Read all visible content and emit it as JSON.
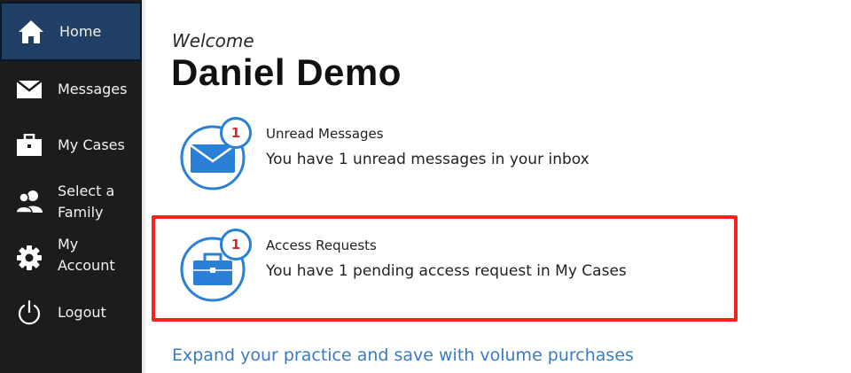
{
  "sidebar": {
    "items": [
      {
        "label": "Home",
        "icon": "home-icon",
        "active": true
      },
      {
        "label": "Messages",
        "icon": "envelope-icon"
      },
      {
        "label": "My Cases",
        "icon": "briefcase-icon"
      },
      {
        "label": "Select a\nFamily",
        "icon": "family-icon"
      },
      {
        "label": "My\nAccount",
        "icon": "gear-icon"
      },
      {
        "label": "Logout",
        "icon": "power-icon"
      }
    ]
  },
  "main": {
    "welcome": "Welcome",
    "user_name": "Daniel Demo",
    "cards": [
      {
        "title": "Unread Messages",
        "text": "You have 1 unread messages in your inbox",
        "badge": "1",
        "icon": "envelope-icon"
      },
      {
        "title": "Access Requests",
        "text": "You have 1 pending access request in My Cases",
        "badge": "1",
        "icon": "briefcase-icon"
      }
    ],
    "promo_link": "Expand your practice and save with volume purchases"
  },
  "colors": {
    "sidebar_bg": "#1c1c1c",
    "active_bg": "#1f3f66",
    "accent_blue": "#2a7fd6",
    "badge_red": "#d7262a",
    "highlight_red": "#f3241a",
    "link_blue": "#3a7ac4"
  }
}
